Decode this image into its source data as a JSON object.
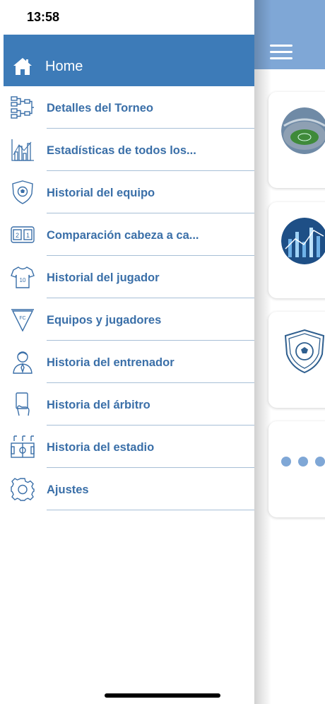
{
  "status_bar": {
    "time": "13:58"
  },
  "drawer": {
    "header": {
      "label": "Home",
      "icon": "home-icon"
    },
    "items": [
      {
        "label": "Detalles del Torneo",
        "icon": "bracket-icon"
      },
      {
        "label": "Estadísticas de todos los...",
        "icon": "bar-chart-icon"
      },
      {
        "label": "Historial del equipo",
        "icon": "shield-ball-icon"
      },
      {
        "label": "Comparación cabeza a ca...",
        "icon": "scoreboard-icon"
      },
      {
        "label": "Historial del jugador",
        "icon": "jersey-icon"
      },
      {
        "label": "Equipos y jugadores",
        "icon": "pennant-icon"
      },
      {
        "label": "Historia del entrenador",
        "icon": "coach-icon"
      },
      {
        "label": "Historia del árbitro",
        "icon": "referee-card-icon"
      },
      {
        "label": "Historia del estadio",
        "icon": "field-icon"
      },
      {
        "label": "Ajustes",
        "icon": "gear-icon"
      }
    ]
  },
  "colors": {
    "header_blue": "#3d7bb8",
    "main_header": "#7fa7d6",
    "item_text": "#3a6fa8"
  }
}
